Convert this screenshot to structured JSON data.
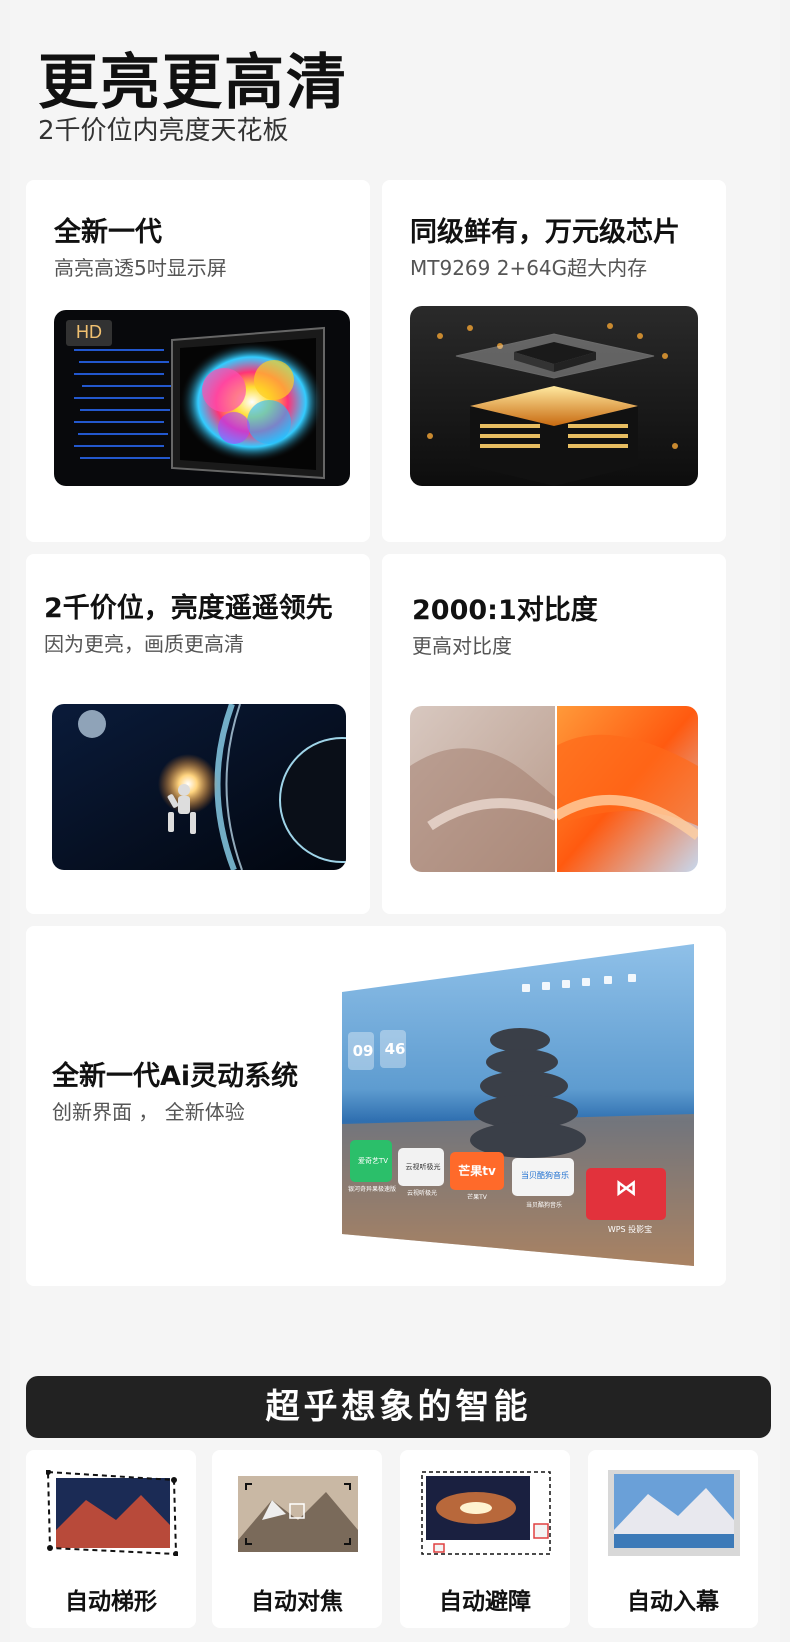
{
  "hero": {
    "title": "更亮更高清",
    "subtitle": "2千价位内亮度天花板"
  },
  "cards": [
    {
      "title": "全新一代",
      "subtitle": "高亮高透5吋显示屏",
      "badge": "HD"
    },
    {
      "title": "同级鲜有，万元级芯片",
      "subtitle": "MT9269 2+64G超大内存"
    },
    {
      "title": "2千价位，亮度遥遥领先",
      "subtitle": "因为更亮，画质更高清"
    },
    {
      "title": "2000:1对比度",
      "subtitle": "更高对比度"
    }
  ],
  "system": {
    "title": "全新一代Ai灵动系统",
    "subtitle": "创新界面 ， 全新体验",
    "clock_hour": "09",
    "clock_minute": "46",
    "apps": [
      {
        "label": "爱奇艺TV",
        "caption": "银河奇异果极速版"
      },
      {
        "label": "云视听极光",
        "caption": "云视听极光"
      },
      {
        "label": "芒果tv",
        "caption": "芒果TV"
      },
      {
        "label": "当贝酷狗音乐",
        "caption": "当贝酷狗音乐"
      },
      {
        "label": "⋈",
        "caption": "WPS 投影宝"
      }
    ]
  },
  "banner": {
    "title": "超乎想象的智能"
  },
  "features": [
    {
      "label": "自动梯形"
    },
    {
      "label": "自动对焦"
    },
    {
      "label": "自动避障"
    },
    {
      "label": "自动入幕"
    }
  ]
}
